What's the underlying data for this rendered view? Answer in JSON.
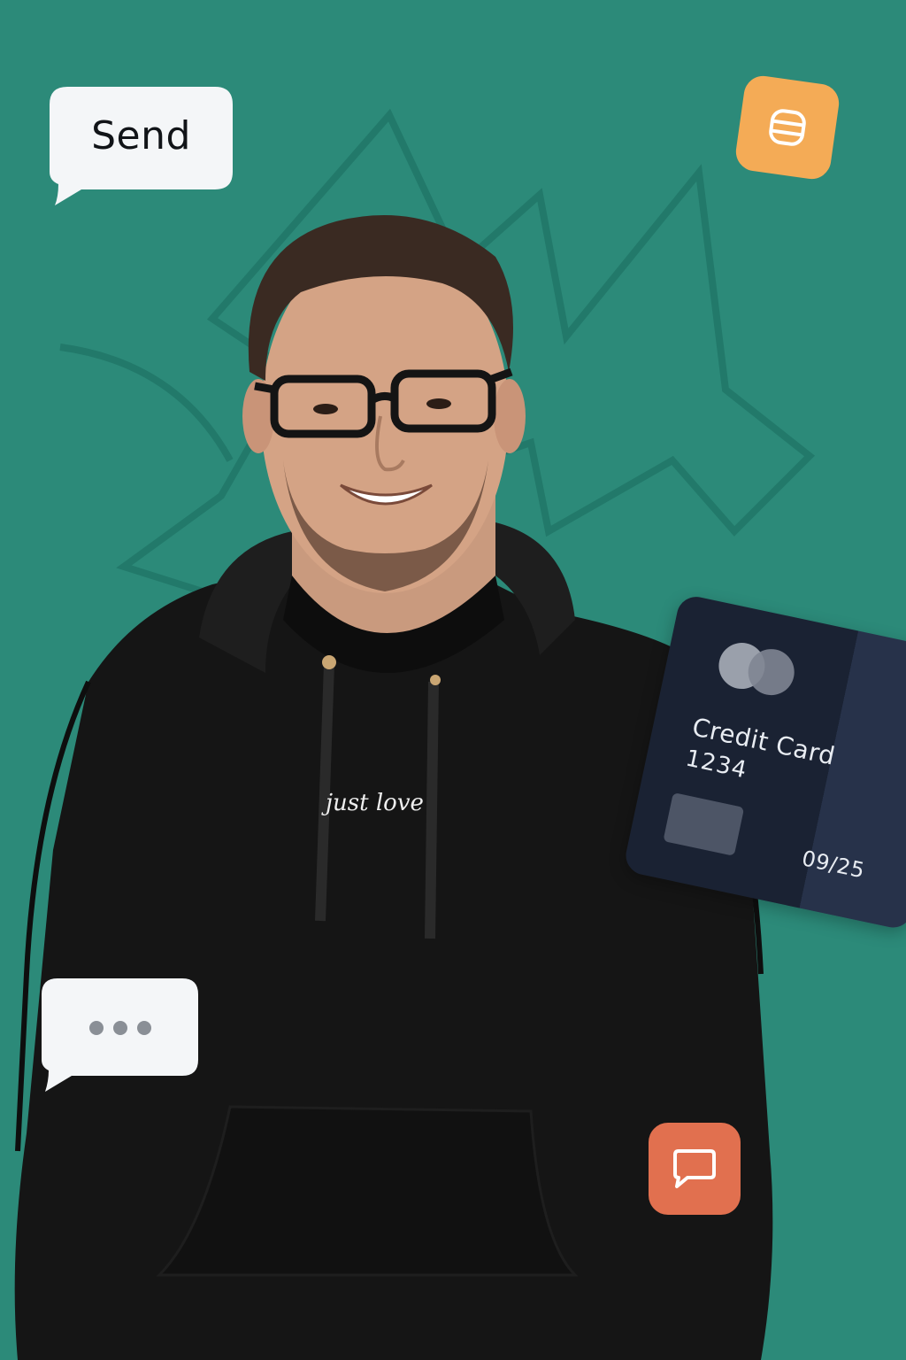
{
  "colors": {
    "background": "#2c8a79",
    "pattern_stroke": "#217464",
    "bubble": "#f4f6f8",
    "app_icon_orange": "#f4ab56",
    "app_icon_coral": "#e1704f",
    "card": "#1a2233",
    "hoodie": "#151515"
  },
  "send_bubble": {
    "label": "Send"
  },
  "typing_bubble": {
    "icon": "ellipsis-icon"
  },
  "app_icons": {
    "top_right": "stack-icon",
    "bottom_right": "chat-icon"
  },
  "credit_card": {
    "title": "Credit Card",
    "number": "1234",
    "expiry": "09/25",
    "logo": "card-network-icon"
  },
  "hoodie": {
    "print_text": "just love"
  }
}
